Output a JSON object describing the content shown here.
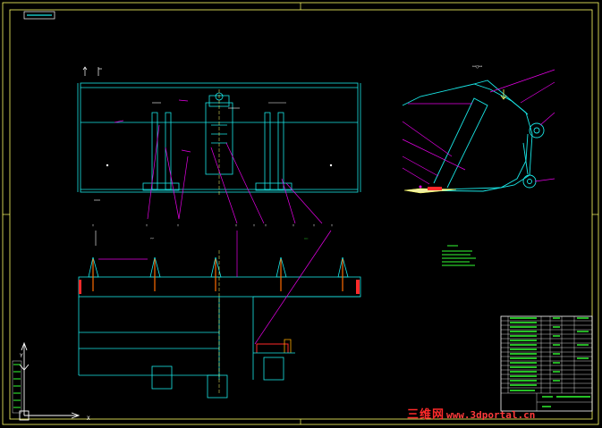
{
  "watermark": {
    "cn": "三维网",
    "url": "www.3dportal.cn"
  },
  "colors": {
    "background": "#000000",
    "frame": "#ffff66",
    "outline_cyan": "#19e6e6",
    "leader_magenta": "#e600e6",
    "notes_green": "#33ff33",
    "watermark_red": "#ff2a2a"
  }
}
